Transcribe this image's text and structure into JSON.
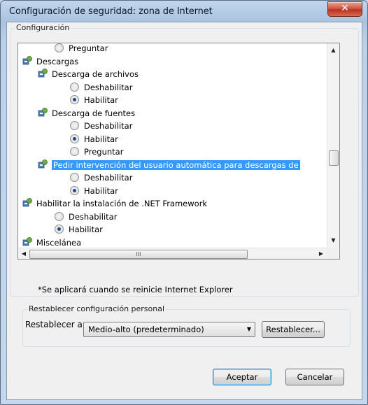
{
  "window": {
    "title": "Configuración de seguridad: zona de Internet",
    "close_label": "✕"
  },
  "settings_group": {
    "label": "Configuración"
  },
  "tree_rows": [
    {
      "text": "Preguntar",
      "kind": "radio",
      "checked": false,
      "indent": 1
    },
    {
      "text": "Descargas",
      "kind": "group",
      "indent": 0
    },
    {
      "text": "Descarga de archivos",
      "kind": "group",
      "indent": 1
    },
    {
      "text": "Deshabilitar",
      "kind": "radio",
      "checked": false,
      "indent": 2
    },
    {
      "text": "Habilitar",
      "kind": "radio",
      "checked": true,
      "indent": 2
    },
    {
      "text": "Descarga de fuentes",
      "kind": "group",
      "indent": 1
    },
    {
      "text": "Deshabilitar",
      "kind": "radio",
      "checked": false,
      "indent": 2
    },
    {
      "text": "Habilitar",
      "kind": "radio",
      "checked": true,
      "indent": 2
    },
    {
      "text": "Preguntar",
      "kind": "radio",
      "checked": false,
      "indent": 2
    },
    {
      "text": "Pedir intervención del usuario automática para descargas de",
      "kind": "group",
      "indent": 1,
      "selected": true
    },
    {
      "text": "Deshabilitar",
      "kind": "radio",
      "checked": false,
      "indent": 2
    },
    {
      "text": "Habilitar",
      "kind": "radio",
      "checked": true,
      "indent": 2
    },
    {
      "text": "Habilitar la instalación de .NET Framework",
      "kind": "group",
      "indent": 0
    },
    {
      "text": "Deshabilitar",
      "kind": "radio",
      "checked": false,
      "indent": 1
    },
    {
      "text": "Habilitar",
      "kind": "radio",
      "checked": true,
      "indent": 1
    },
    {
      "text": "Miscelánea",
      "kind": "group",
      "indent": 0
    }
  ],
  "scroll": {
    "h_thumb_glyph": "III"
  },
  "note": "*Se aplicará cuando se reinicie Internet Explorer",
  "reset_group": {
    "label": "Restablecer configuración personal",
    "reset_to_label": "Restablecer a:",
    "selected_level": "Medio-alto (predeterminado)",
    "reset_button": "Restablecer..."
  },
  "buttons": {
    "ok": "Aceptar",
    "cancel": "Cancelar"
  },
  "colors": {
    "selection": "#3399ff",
    "title_bar": "#b9d1ea"
  }
}
